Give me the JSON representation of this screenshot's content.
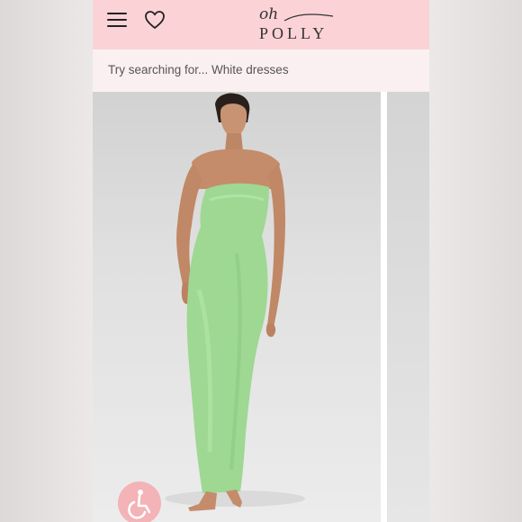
{
  "header": {
    "logo_script": "oh",
    "logo_wordmark": "POLLY"
  },
  "search": {
    "prompt": "Try searching for... White dresses"
  },
  "colors": {
    "header_bg": "#fbd3d6",
    "search_bg": "#fbf0f1",
    "dress": "#9ed893",
    "accessibility_bg": "#f3b3b7"
  },
  "icons": {
    "menu": "hamburger-menu-icon",
    "wishlist": "heart-icon",
    "accessibility": "wheelchair-icon"
  }
}
